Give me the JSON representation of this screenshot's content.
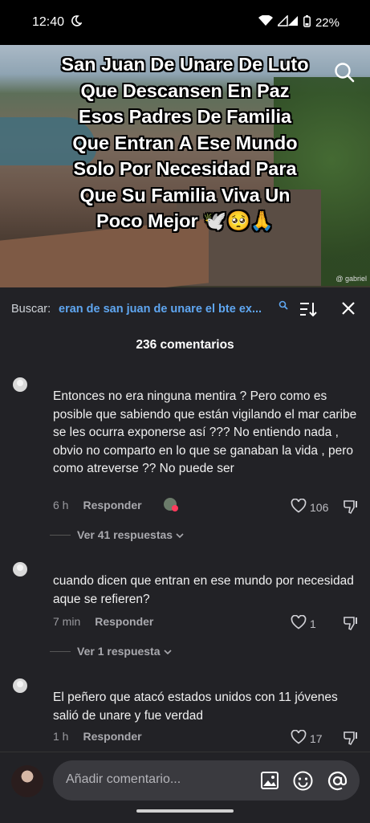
{
  "status": {
    "time": "12:40",
    "battery": "22%"
  },
  "video": {
    "caption_lines": [
      "San Juan De Unare De Luto",
      "Que Descansen En Paz",
      "Esos Padres De Familia",
      "Que Entran A Ese Mundo",
      "Solo Por Necesidad Para",
      "Que Su Familia Viva Un",
      "Poco Mejor 🕊️🥺🙏"
    ],
    "watermark": "@ gabriel"
  },
  "search": {
    "label": "Buscar:",
    "query": "eran de san juan de unare el bte ex..."
  },
  "comments_count": "236 comentarios",
  "comments": [
    {
      "text": "Entonces no era ninguna mentira ? Pero como es posible que sabiendo que están vigilando el mar caribe se les ocurra exponerse así ??? No entiendo nada , obvio no comparto en lo que se ganaban la vida , pero como atreverse ?? No puede ser",
      "time": "6 h",
      "reply_label": "Responder",
      "likes": "106",
      "replies_label": "Ver 41 respuestas"
    },
    {
      "text": "cuando dicen que entran en ese mundo por necesidad aque se refieren?",
      "time": "7 min",
      "reply_label": "Responder",
      "likes": "1",
      "replies_label": "Ver 1 respuesta"
    },
    {
      "text": "El peñero que atacó estados unidos con 11 jóvenes salió de unare y fue verdad",
      "time": "1 h",
      "reply_label": "Responder",
      "likes": "17",
      "replies_label": ""
    }
  ],
  "input": {
    "placeholder": "Añadir comentario..."
  },
  "icons": [
    "moon-icon",
    "wifi-icon",
    "signal-icon",
    "battery-icon",
    "search-icon",
    "sort-icon",
    "close-icon",
    "heart-icon",
    "dislike-icon",
    "chevron-down-icon",
    "image-icon",
    "emoji-icon",
    "at-icon"
  ]
}
